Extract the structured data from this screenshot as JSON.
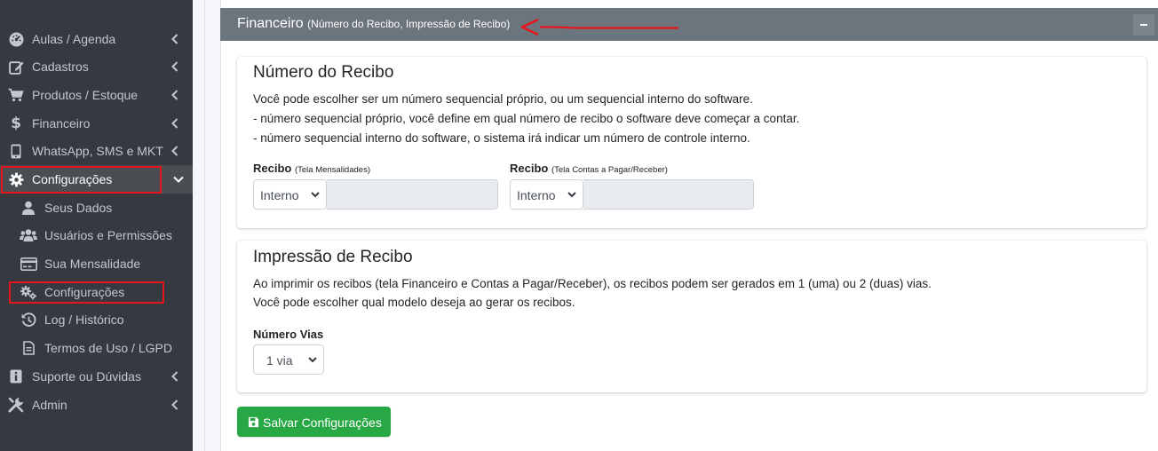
{
  "sidebar": {
    "items": [
      {
        "label": "Aulas / Agenda",
        "icon": "dashboard-icon"
      },
      {
        "label": "Cadastros",
        "icon": "edit-icon"
      },
      {
        "label": "Produtos / Estoque",
        "icon": "cart-icon"
      },
      {
        "label": "Financeiro",
        "icon": "dollar-icon"
      },
      {
        "label": "WhatsApp, SMS e MKT",
        "icon": "mobile-icon"
      },
      {
        "label": "Configurações",
        "icon": "gear-icon"
      },
      {
        "label": "Suporte ou Dúvidas",
        "icon": "info-icon"
      },
      {
        "label": "Admin",
        "icon": "tools-icon"
      }
    ],
    "subitems": [
      {
        "label": "Seus Dados",
        "icon": "user-icon"
      },
      {
        "label": "Usuários e Permissões",
        "icon": "users-icon"
      },
      {
        "label": "Sua Mensalidade",
        "icon": "credit-card-icon"
      },
      {
        "label": "Configurações",
        "icon": "cogs-icon"
      },
      {
        "label": "Log / Histórico",
        "icon": "history-icon"
      },
      {
        "label": "Termos de Uso / LGPD",
        "icon": "file-icon"
      }
    ]
  },
  "header": {
    "title": "Financeiro",
    "subtitle": "(Número do Recibo, Impressão de Recibo)"
  },
  "recibo_numero": {
    "title": "Número do Recibo",
    "lines": [
      "Você pode escolher ser um número sequencial próprio, ou um sequencial interno do software.",
      "- número sequencial próprio, você define em qual número de recibo o software deve começar a contar.",
      "- número sequencial interno do software, o sistema irá indicar um número de controle interno."
    ],
    "field1": {
      "label": "Recibo",
      "hint": "(Tela Mensalidades)",
      "value": "Interno"
    },
    "field2": {
      "label": "Recibo",
      "hint": "(Tela Contas a Pagar/Receber)",
      "value": "Interno"
    }
  },
  "impressao": {
    "title": "Impressão de Recibo",
    "lines": [
      "Ao imprimir os recibos (tela Financeiro e Contas a Pagar/Receber), os recibos podem ser gerados em 1 (uma) ou 2 (duas) vias.",
      "Você pode escolher qual modelo deseja ao gerar os recibos."
    ],
    "vias": {
      "label": "Número Vias",
      "value": "1 via"
    }
  },
  "save_button": {
    "label": "Salvar Configurações"
  },
  "colors": {
    "sidebar_bg": "#343a40",
    "header_bg": "#6c757d",
    "success": "#28a745",
    "highlight": "#e8141c"
  }
}
